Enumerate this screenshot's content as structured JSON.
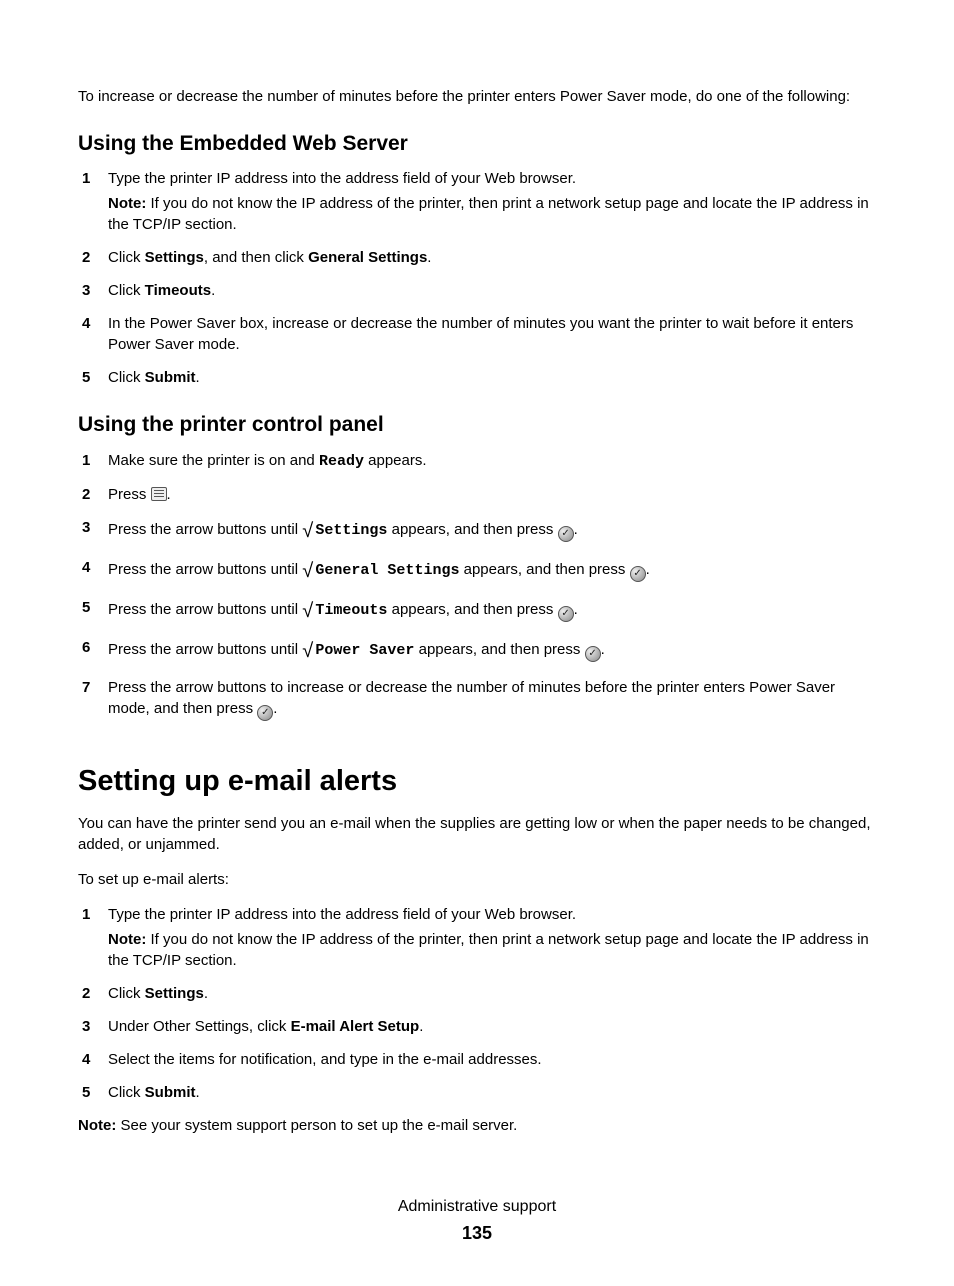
{
  "intro": "To increase or decrease the number of minutes before the printer enters Power Saver mode, do one of the following:",
  "section1": {
    "heading": "Using the Embedded Web Server",
    "step1": "Type the printer IP address into the address field of your Web browser.",
    "step1_note_label": "Note:",
    "step1_note": " If you do not know the IP address of the printer, then print a network setup page and locate the IP address in the TCP/IP section.",
    "step2_a": "Click ",
    "step2_b": "Settings",
    "step2_c": ", and then click ",
    "step2_d": "General Settings",
    "step2_e": ".",
    "step3_a": "Click ",
    "step3_b": "Timeouts",
    "step3_c": ".",
    "step4": "In the Power Saver box, increase or decrease the number of minutes you want the printer to wait before it enters Power Saver mode.",
    "step5_a": "Click ",
    "step5_b": "Submit",
    "step5_c": "."
  },
  "section2": {
    "heading": "Using the printer control panel",
    "step1_a": "Make sure the printer is on and ",
    "step1_b": "Ready",
    "step1_c": " appears.",
    "step2_a": "Press ",
    "step2_b": ".",
    "step3_a": "Press the arrow buttons until ",
    "step3_b": "Settings",
    "step3_c": " appears, and then press ",
    "step3_d": ".",
    "step4_a": "Press the arrow buttons until ",
    "step4_b": "General Settings",
    "step4_c": " appears, and then press ",
    "step4_d": ".",
    "step5_a": "Press the arrow buttons until ",
    "step5_b": "Timeouts",
    "step5_c": " appears, and then press ",
    "step5_d": ".",
    "step6_a": "Press the arrow buttons until ",
    "step6_b": "Power Saver",
    "step6_c": " appears, and then press ",
    "step6_d": ".",
    "step7_a": "Press the arrow buttons to increase or decrease the number of minutes before the printer enters Power Saver mode, and then press ",
    "step7_b": "."
  },
  "section3": {
    "heading": "Setting up e-mail alerts",
    "intro": "You can have the printer send you an e-mail when the supplies are getting low or when the paper needs to be changed, added, or unjammed.",
    "lead": "To set up e-mail alerts:",
    "step1": "Type the printer IP address into the address field of your Web browser.",
    "step1_note_label": "Note:",
    "step1_note": " If you do not know the IP address of the printer, then print a network setup page and locate the IP address in the TCP/IP section.",
    "step2_a": "Click ",
    "step2_b": "Settings",
    "step2_c": ".",
    "step3_a": "Under Other Settings, click ",
    "step3_b": "E-mail Alert Setup",
    "step3_c": ".",
    "step4": "Select the items for notification, and type in the e-mail addresses.",
    "step5_a": "Click ",
    "step5_b": "Submit",
    "step5_c": ".",
    "end_note_label": "Note:",
    "end_note": " See your system support person to set up the e-mail server."
  },
  "footer": {
    "title": "Administrative support",
    "page": "135"
  }
}
